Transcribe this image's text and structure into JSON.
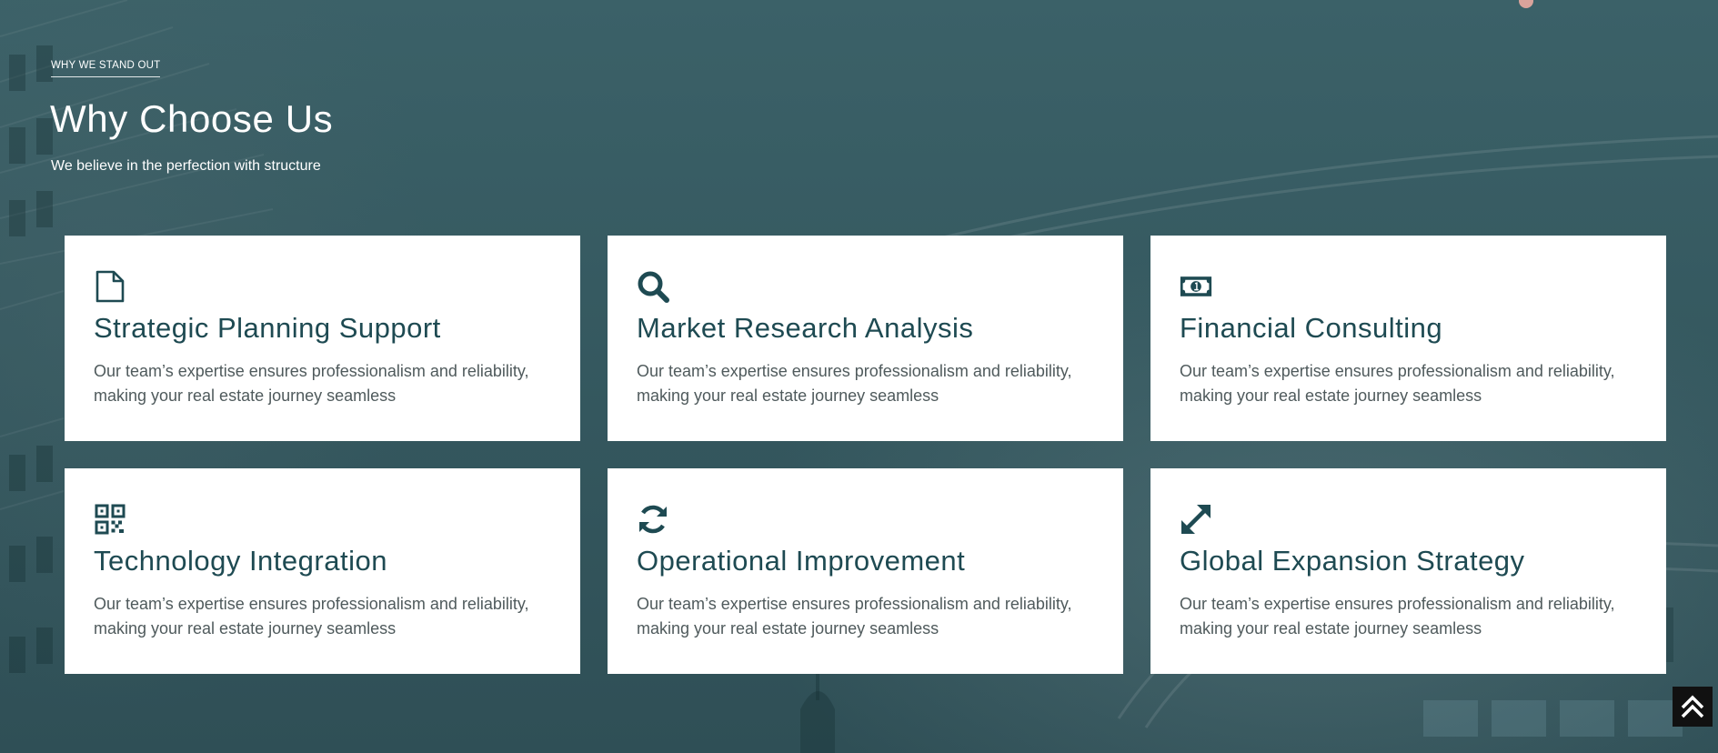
{
  "section": {
    "eyebrow": "WHY WE STAND OUT",
    "title": "Why Choose Us",
    "subtitle": "We believe in the perfection with structure"
  },
  "cards": [
    {
      "icon": "file-icon",
      "title": "Strategic Planning Support",
      "description": "Our team’s expertise ensures professionalism and reliability, making your real estate journey seamless"
    },
    {
      "icon": "search-icon",
      "title": "Market Research Analysis",
      "description": "Our team’s expertise ensures professionalism and reliability, making your real estate journey seamless"
    },
    {
      "icon": "money-bill-icon",
      "title": "Financial Consulting",
      "description": "Our team’s expertise ensures professionalism and reliability, making your real estate journey seamless"
    },
    {
      "icon": "qr-code-icon",
      "title": "Technology Integration",
      "description": "Our team’s expertise ensures professionalism and reliability, making your real estate journey seamless"
    },
    {
      "icon": "refresh-icon",
      "title": "Operational Improvement",
      "description": "Our team’s expertise ensures professionalism and reliability, making your real estate journey seamless"
    },
    {
      "icon": "expand-icon",
      "title": "Global Expansion Strategy",
      "description": "Our team’s expertise ensures professionalism and reliability, making your real estate journey seamless"
    }
  ],
  "scroll_top": {
    "icon": "double-chevron-up-icon"
  },
  "colors": {
    "background": "#35585f",
    "card_background": "#ffffff",
    "heading_accent": "#1e4a52",
    "body_text": "#4f5a5c",
    "scroll_button": "#111111",
    "dot_accent": "#d9a39b"
  }
}
